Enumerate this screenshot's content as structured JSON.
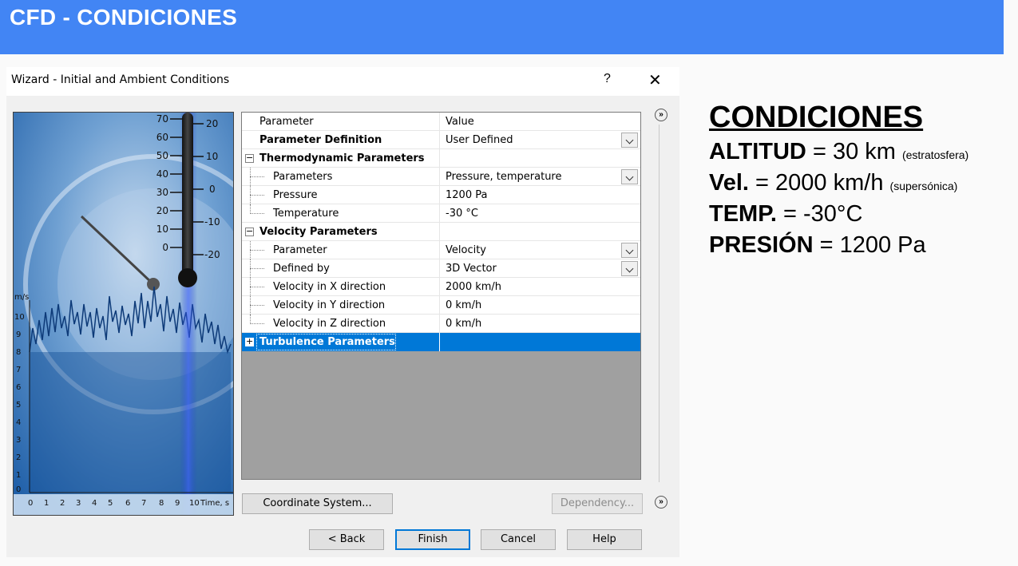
{
  "slide": {
    "title": "CFD - CONDICIONES"
  },
  "dialog": {
    "title": "Wizard - Initial and Ambient Conditions",
    "help_label": "?",
    "close_label": "✕",
    "expand_label": "»",
    "thermometer_labels": {
      "left": [
        "70",
        "60",
        "50",
        "40",
        "30",
        "20",
        "10",
        "0"
      ],
      "right": [
        "20",
        "10",
        "0",
        "-10",
        "-20"
      ]
    },
    "chart_labels": {
      "y_unit": "m/s",
      "y_ticks": [
        "10",
        "9",
        "8",
        "7",
        "6",
        "5",
        "4",
        "3",
        "2",
        "1",
        "0"
      ],
      "x_ticks": [
        "0",
        "1",
        "2",
        "3",
        "4",
        "5",
        "6",
        "7",
        "8",
        "9",
        "10"
      ],
      "x_unit": "Time, s"
    },
    "grid": {
      "header": {
        "name": "Parameter",
        "value": "Value"
      },
      "rows": [
        {
          "name": "Parameter Definition",
          "value": "User Defined"
        },
        {
          "name": "Thermodynamic Parameters",
          "value": ""
        },
        {
          "name": "Parameters",
          "value": "Pressure, temperature"
        },
        {
          "name": "Pressure",
          "value": "1200 Pa"
        },
        {
          "name": "Temperature",
          "value": "-30 °C"
        },
        {
          "name": "Velocity Parameters",
          "value": ""
        },
        {
          "name": "Parameter",
          "value": "Velocity"
        },
        {
          "name": "Defined by",
          "value": "3D Vector"
        },
        {
          "name": "Velocity in X direction",
          "value": "2000 km/h"
        },
        {
          "name": "Velocity in Y direction",
          "value": "0 km/h"
        },
        {
          "name": "Velocity in Z direction",
          "value": "0 km/h"
        },
        {
          "name": "Turbulence Parameters",
          "value": ""
        }
      ]
    },
    "buttons": {
      "coordinate_system": "Coordinate System...",
      "dependency": "Dependency...",
      "back": "< Back",
      "finish": "Finish",
      "cancel": "Cancel",
      "help": "Help"
    }
  },
  "notes": {
    "heading": "CONDICIONES",
    "altitude": {
      "label": "ALTITUD",
      "value": " = 30 km ",
      "note": "(estratosfera)"
    },
    "velocity": {
      "label": "Vel.",
      "value": " = 2000 km/h ",
      "note": "(supersónica)"
    },
    "temperature": {
      "label": "TEMP.",
      "value": " = -30°C"
    },
    "pressure": {
      "label": "PRESIÓN",
      "value": " = 1200 Pa"
    }
  }
}
